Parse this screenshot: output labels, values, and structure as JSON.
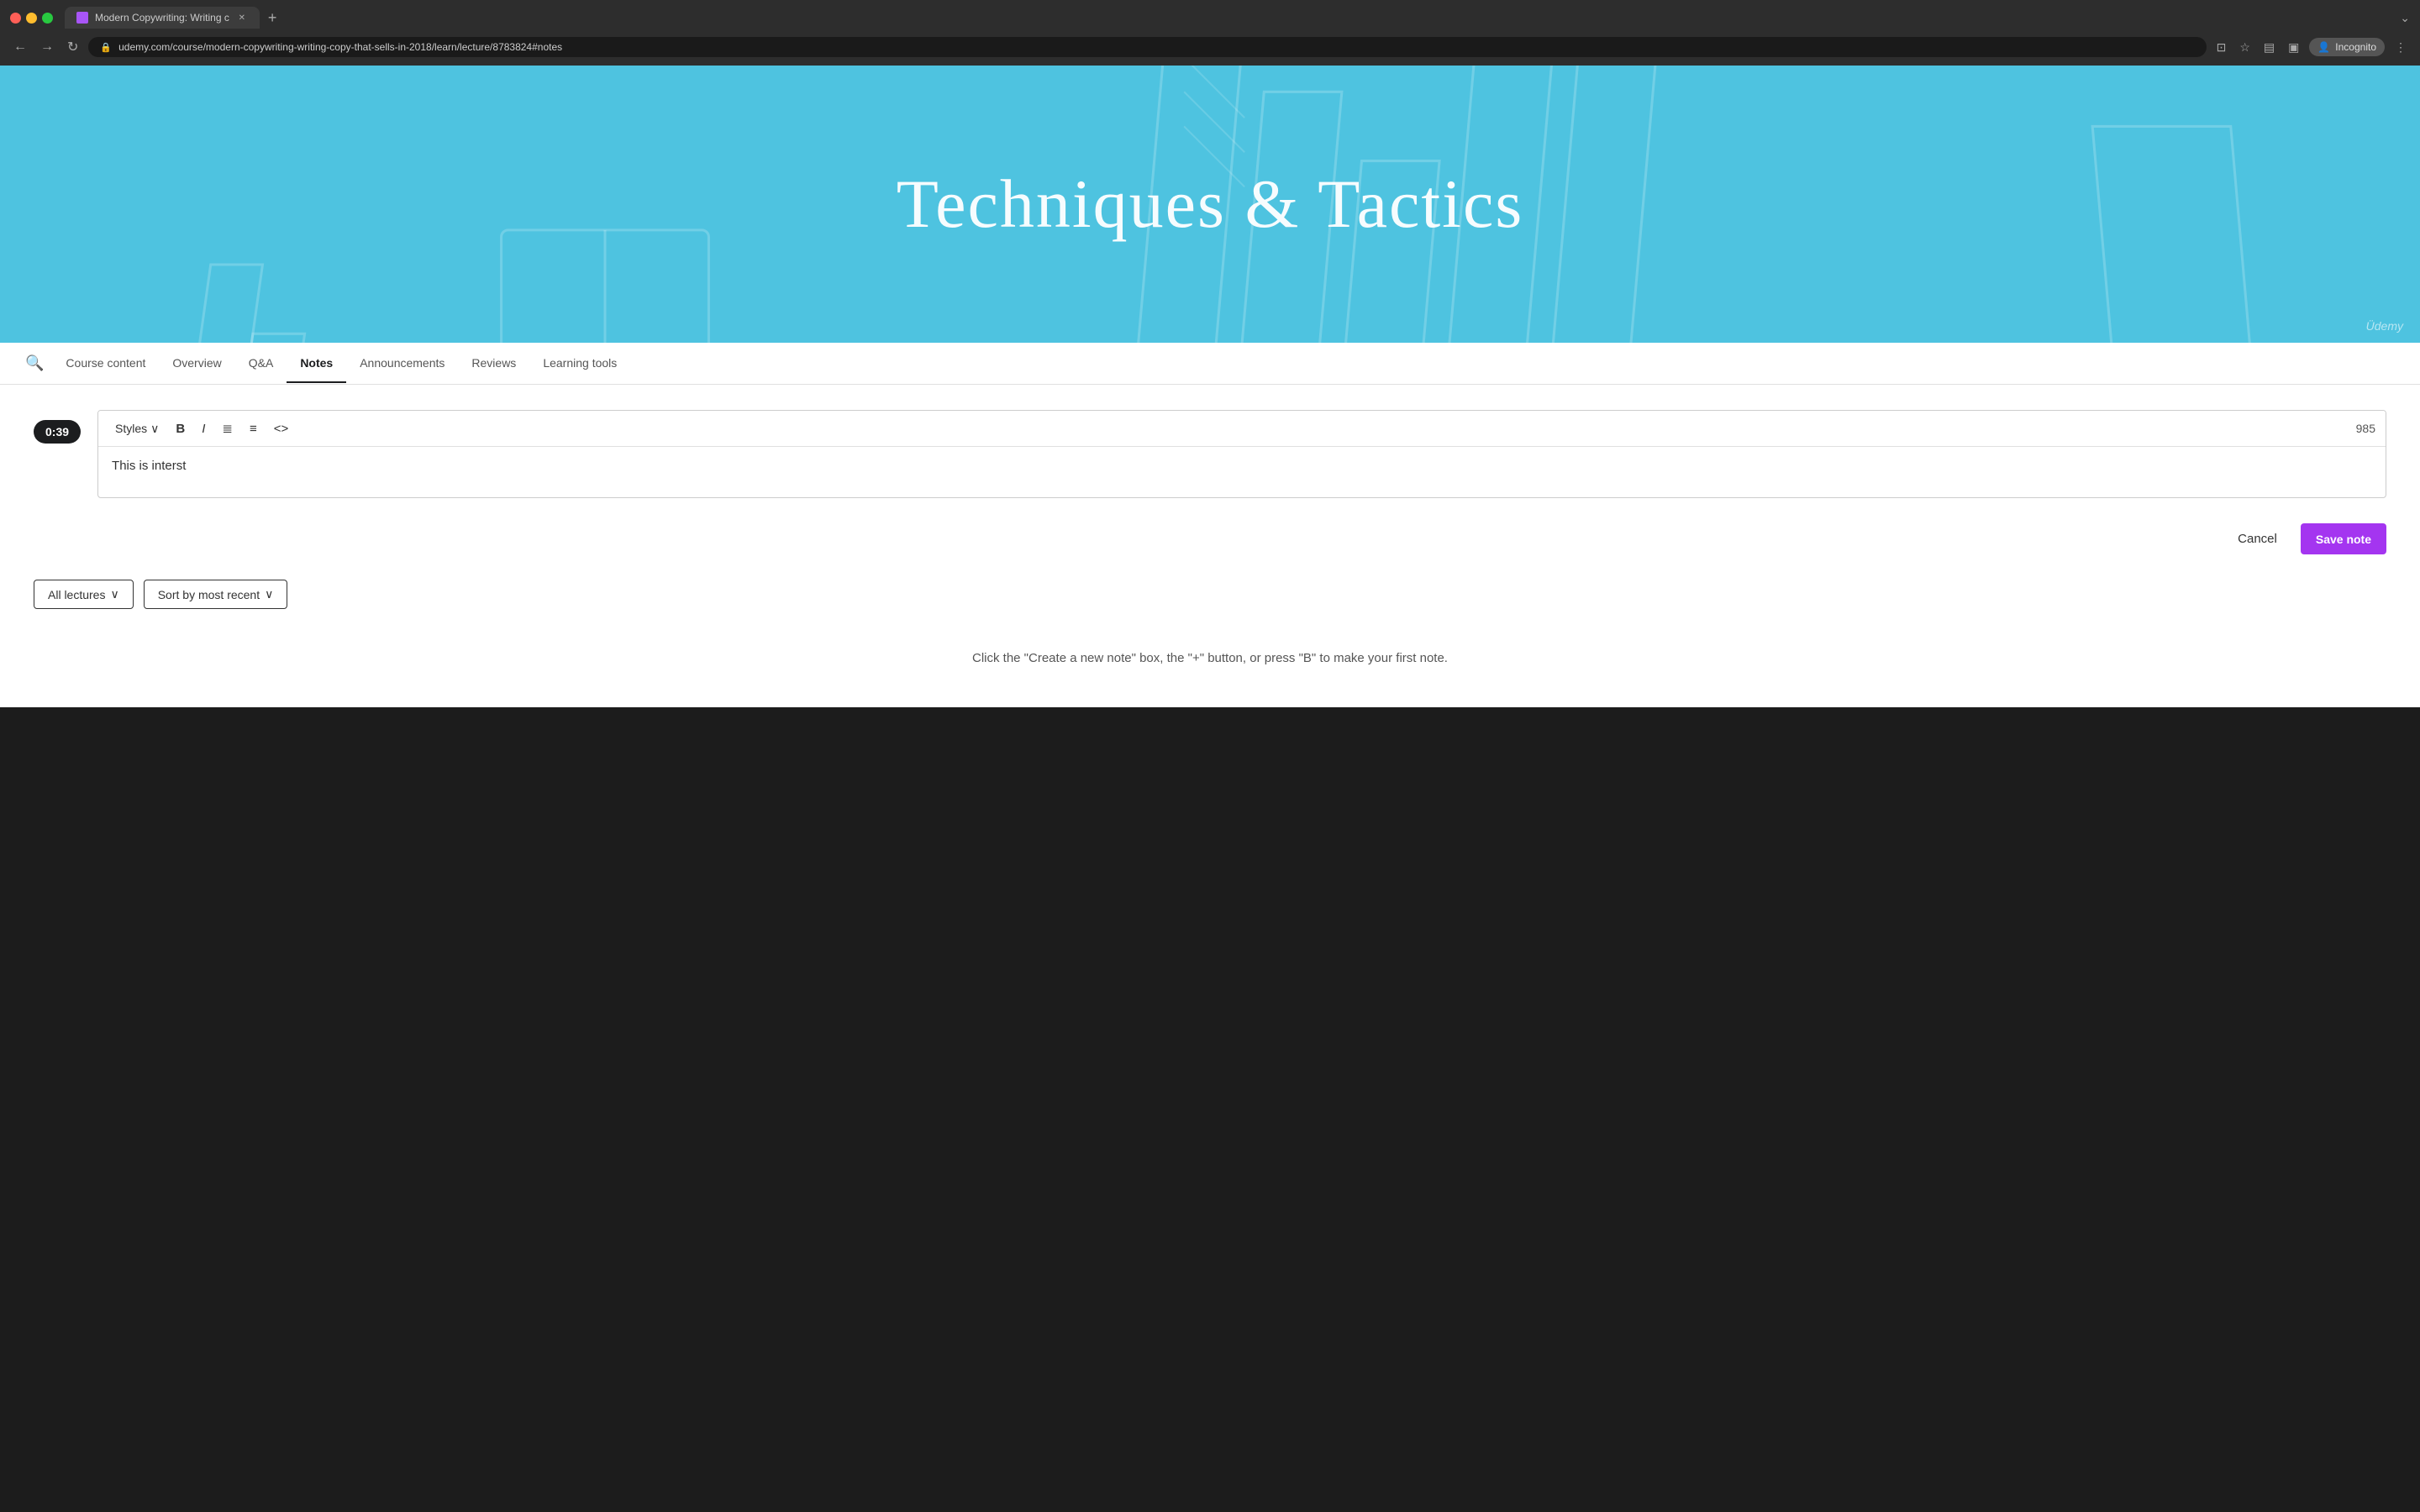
{
  "browser": {
    "tab_title": "Modern Copywriting: Writing c",
    "url": "udemy.com/course/modern-copywriting-writing-copy-that-sells-in-2018/learn/lecture/8783824#notes",
    "incognito_label": "Incognito"
  },
  "hero": {
    "title": "Techniques & Tactics",
    "watermark": "Üdemy"
  },
  "nav": {
    "search_icon": "🔍",
    "tabs": [
      {
        "label": "Course content",
        "active": false
      },
      {
        "label": "Overview",
        "active": false
      },
      {
        "label": "Q&A",
        "active": false
      },
      {
        "label": "Notes",
        "active": true
      },
      {
        "label": "Announcements",
        "active": false
      },
      {
        "label": "Reviews",
        "active": false
      },
      {
        "label": "Learning tools",
        "active": false
      }
    ]
  },
  "editor": {
    "timestamp": "0:39",
    "toolbar": {
      "styles_label": "Styles",
      "bold": "B",
      "italic": "I",
      "ordered_list": "≡",
      "unordered_list": "☰",
      "code": "<>",
      "char_count": "985"
    },
    "content": "This is interst"
  },
  "actions": {
    "cancel_label": "Cancel",
    "save_label": "Save note"
  },
  "filters": {
    "lectures_label": "All lectures",
    "sort_label": "Sort by most recent"
  },
  "hint": {
    "text": "Click the \"Create a new note\" box, the \"+\" button, or press \"B\" to make your first note."
  }
}
